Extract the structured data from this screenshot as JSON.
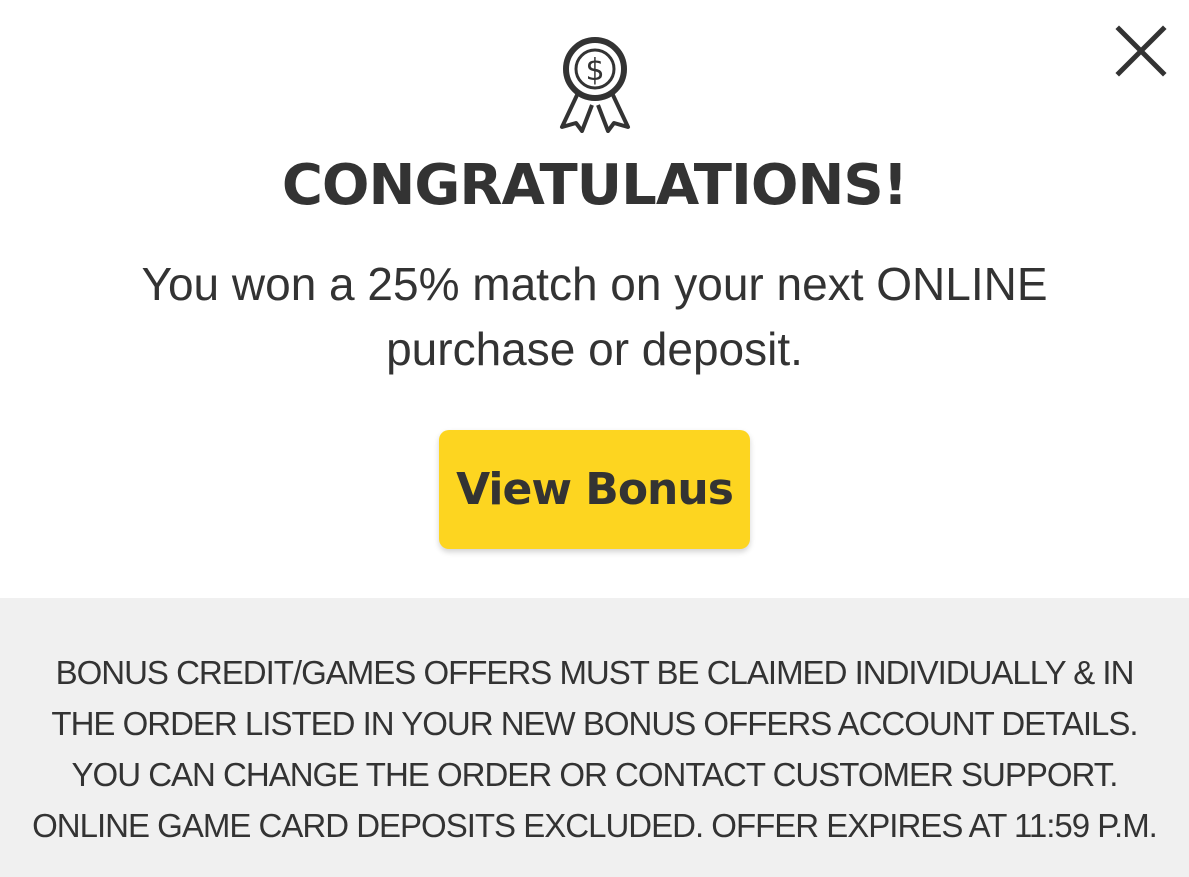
{
  "modal": {
    "close_icon": "close-icon",
    "badge_icon": "dollar-award-ribbon-icon",
    "title": "CONGRATULATIONS!",
    "message_line1": "You won a 25% match on your next ONLINE",
    "message_line2": "purchase or deposit.",
    "button_label": "View Bonus",
    "button_color": "#fdd520",
    "disclaimer_lines": [
      "BONUS CREDIT/GAMES OFFERS MUST BE CLAIMED INDIVIDUALLY & IN",
      "THE ORDER LISTED IN YOUR NEW BONUS OFFERS ACCOUNT DETAILS.",
      "YOU CAN CHANGE THE ORDER OR CONTACT CUSTOMER SUPPORT.",
      "ONLINE GAME CARD DEPOSITS EXCLUDED. OFFER EXPIRES AT 11:59 P.M."
    ]
  }
}
